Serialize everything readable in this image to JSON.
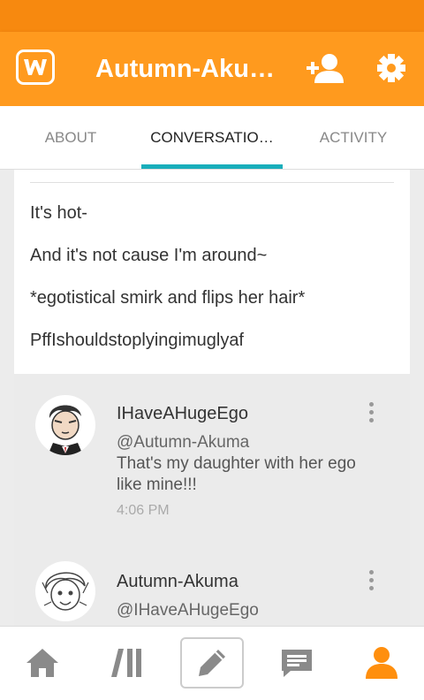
{
  "app": {
    "title": "Autumn-Aku…",
    "accent_color": "#ff9a1e",
    "logo_icon": "wattpad-logo-icon",
    "actions": [
      "add-user-icon",
      "gear-icon"
    ]
  },
  "tabs": [
    {
      "label": "ABOUT",
      "active": false
    },
    {
      "label": "CONVERSATIO…",
      "active": true
    },
    {
      "label": "ACTIVITY",
      "active": false
    }
  ],
  "post": {
    "lines": [
      "It's hot-",
      "And it's not cause I'm around~",
      "*egotistical smirk and flips her hair*",
      "PffIshouldstoplyingimuglyaf"
    ]
  },
  "comments": [
    {
      "author": "IHaveAHugeEgo",
      "mention": "@Autumn-Akuma",
      "text": "That's my daughter with her ego like mine!!!",
      "time": "4:06 PM"
    },
    {
      "author": "Autumn-Akuma",
      "mention": "@IHaveAHugeEgo"
    }
  ],
  "bottom_nav": [
    {
      "icon": "home-icon",
      "active": false
    },
    {
      "icon": "library-icon",
      "active": false
    },
    {
      "icon": "pencil-icon",
      "active": false
    },
    {
      "icon": "messages-icon",
      "active": false
    },
    {
      "icon": "profile-icon",
      "active": true
    }
  ]
}
